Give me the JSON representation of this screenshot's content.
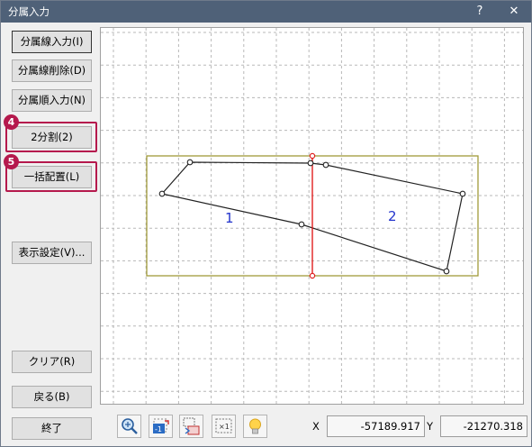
{
  "window": {
    "title": "分属入力",
    "help_label": "?",
    "close_label": "✕"
  },
  "buttons": {
    "line_input": "分属線入力(I)",
    "line_delete": "分属線削除(D)",
    "order_input": "分属順入力(N)",
    "split2": "2分割(2)",
    "batch_place": "一括配置(L)",
    "display_settings": "表示設定(V)...",
    "clear": "クリア(R)",
    "back": "戻る(B)",
    "finish": "終了"
  },
  "steps": {
    "split2_step": "4",
    "batch_step": "5"
  },
  "canvas": {
    "parcel_labels": [
      "1",
      "2"
    ],
    "colors": {
      "grid": "#b8b8b8",
      "frame": "#a09a3a",
      "divider": "#e02020",
      "label": "#2233cc"
    }
  },
  "toolbar": {
    "icons": [
      "zoom-icon",
      "scale-1-icon",
      "transfer-icon",
      "fit-x1-icon",
      "bulb-icon"
    ]
  },
  "coords": {
    "x_label": "X",
    "x_value": "-57189.917",
    "y_label": "Y",
    "y_value": "-21270.318"
  },
  "colors": {
    "titlebar": "#4f6178",
    "highlight": "#b5194d"
  }
}
